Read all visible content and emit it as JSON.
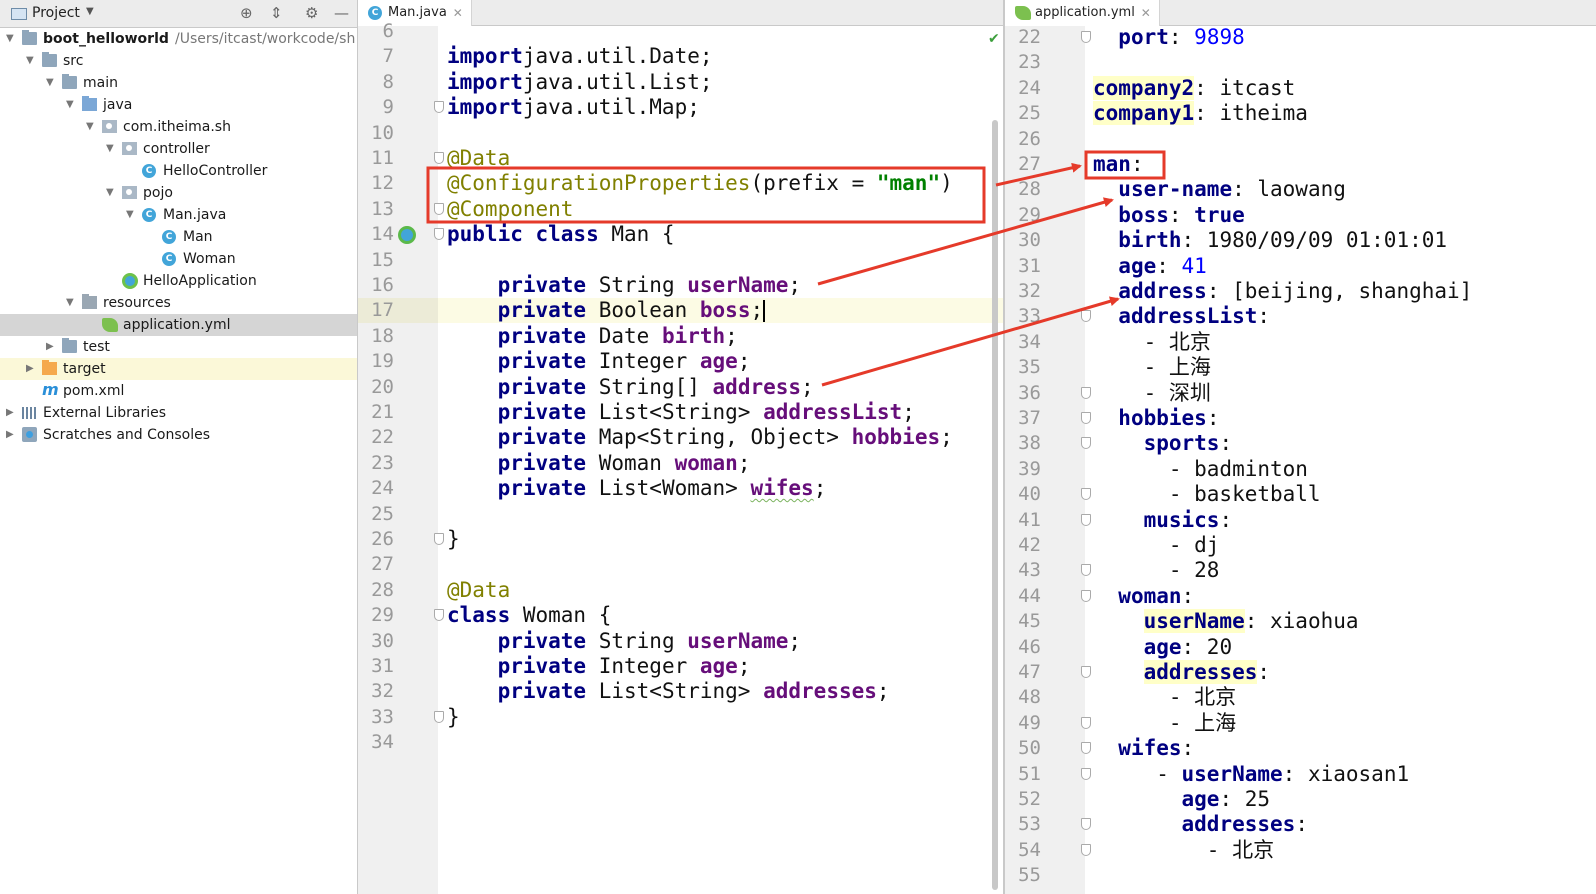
{
  "project_panel": {
    "header": {
      "title": "Project"
    },
    "tree": [
      {
        "label": "boot_helloworld",
        "path": "/Users/itcast/workcode/sh",
        "icon": "module-folder-icon",
        "depth": 0,
        "arrow": "down"
      },
      {
        "label": "src",
        "icon": "folder-icon",
        "depth": 1,
        "arrow": "down"
      },
      {
        "label": "main",
        "icon": "folder-icon",
        "depth": 2,
        "arrow": "down"
      },
      {
        "label": "java",
        "icon": "source-folder-icon",
        "depth": 3,
        "arrow": "down"
      },
      {
        "label": "com.itheima.sh",
        "icon": "package-icon",
        "depth": 4,
        "arrow": "down"
      },
      {
        "label": "controller",
        "icon": "package-icon",
        "depth": 5,
        "arrow": "down"
      },
      {
        "label": "HelloController",
        "icon": "class-icon",
        "depth": 6,
        "arrow": ""
      },
      {
        "label": "pojo",
        "icon": "package-icon",
        "depth": 5,
        "arrow": "down"
      },
      {
        "label": "Man.java",
        "icon": "class-icon",
        "depth": 6,
        "arrow": "down"
      },
      {
        "label": "Man",
        "icon": "class-icon",
        "depth": 7,
        "arrow": ""
      },
      {
        "label": "Woman",
        "icon": "class-icon",
        "depth": 7,
        "arrow": ""
      },
      {
        "label": "HelloApplication",
        "icon": "spring-app-icon",
        "depth": 5,
        "arrow": ""
      },
      {
        "label": "resources",
        "icon": "resources-folder-icon",
        "depth": 3,
        "arrow": "down"
      },
      {
        "label": "application.yml",
        "icon": "yml-file-icon",
        "depth": 4,
        "arrow": ""
      },
      {
        "label": "test",
        "icon": "folder-icon",
        "depth": 2,
        "arrow": "right"
      },
      {
        "label": "target",
        "icon": "target-folder-icon",
        "depth": 1,
        "arrow": "right"
      },
      {
        "label": "pom.xml",
        "icon": "maven-icon",
        "depth": 1,
        "arrow": ""
      },
      {
        "label": "External Libraries",
        "icon": "libraries-icon",
        "depth": 0,
        "arrow": "right"
      },
      {
        "label": "Scratches and Consoles",
        "icon": "scratches-icon",
        "depth": 0,
        "arrow": "right"
      }
    ]
  },
  "java_editor": {
    "tab": "Man.java",
    "lines": [
      {
        "n": "6",
        "segs": []
      },
      {
        "n": "7",
        "segs": [
          [
            "kw",
            "import"
          ],
          [
            "",
            "java.util.Date;"
          ]
        ]
      },
      {
        "n": "8",
        "segs": [
          [
            "kw",
            "import"
          ],
          [
            "",
            "java.util.List;"
          ]
        ]
      },
      {
        "n": "9",
        "segs": [
          [
            "kw",
            "import"
          ],
          [
            "",
            "java.util.Map;"
          ]
        ]
      },
      {
        "n": "10",
        "segs": []
      },
      {
        "n": "11",
        "segs": [
          [
            "ann",
            "@Data"
          ]
        ]
      },
      {
        "n": "12",
        "segs": [
          [
            "ann",
            "@ConfigurationProperties"
          ],
          [
            "",
            "(prefix = "
          ],
          [
            "str",
            "\"man\""
          ],
          [
            "",
            ")"
          ]
        ]
      },
      {
        "n": "13",
        "segs": [
          [
            "ann",
            "@Component"
          ]
        ]
      },
      {
        "n": "14",
        "segs": [
          [
            "kw",
            "public class"
          ],
          [
            "",
            " Man {"
          ]
        ]
      },
      {
        "n": "15",
        "segs": []
      },
      {
        "n": "16",
        "segs": [
          [
            "",
            "    "
          ],
          [
            "kw",
            "private"
          ],
          [
            "",
            " String "
          ],
          [
            "fld",
            "userName"
          ],
          [
            "",
            ";"
          ]
        ]
      },
      {
        "n": "17",
        "segs": [
          [
            "",
            "    "
          ],
          [
            "kw",
            "private"
          ],
          [
            "",
            " Boolean "
          ],
          [
            "fld",
            "boss"
          ],
          [
            "",
            ";"
          ]
        ]
      },
      {
        "n": "18",
        "segs": [
          [
            "",
            "    "
          ],
          [
            "kw",
            "private"
          ],
          [
            "",
            " Date "
          ],
          [
            "fld",
            "birth"
          ],
          [
            "",
            ";"
          ]
        ]
      },
      {
        "n": "19",
        "segs": [
          [
            "",
            "    "
          ],
          [
            "kw",
            "private"
          ],
          [
            "",
            " Integer "
          ],
          [
            "fld",
            "age"
          ],
          [
            "",
            ";"
          ]
        ]
      },
      {
        "n": "20",
        "segs": [
          [
            "",
            "    "
          ],
          [
            "kw",
            "private"
          ],
          [
            "",
            " String[] "
          ],
          [
            "fld",
            "address"
          ],
          [
            "",
            ";"
          ]
        ]
      },
      {
        "n": "21",
        "segs": [
          [
            "",
            "    "
          ],
          [
            "kw",
            "private"
          ],
          [
            "",
            " List<String> "
          ],
          [
            "fld",
            "addressList"
          ],
          [
            "",
            ";"
          ]
        ]
      },
      {
        "n": "22",
        "segs": [
          [
            "",
            "    "
          ],
          [
            "kw",
            "private"
          ],
          [
            "",
            " Map<String, Object> "
          ],
          [
            "fld",
            "hobbies"
          ],
          [
            "",
            ";"
          ]
        ]
      },
      {
        "n": "23",
        "segs": [
          [
            "",
            "    "
          ],
          [
            "kw",
            "private"
          ],
          [
            "",
            " Woman "
          ],
          [
            "fld",
            "woman"
          ],
          [
            "",
            ";"
          ]
        ]
      },
      {
        "n": "24",
        "segs": [
          [
            "",
            "    "
          ],
          [
            "kw",
            "private"
          ],
          [
            "",
            " List<Woman> "
          ],
          [
            "fld squig",
            "wifes"
          ],
          [
            "",
            ";"
          ]
        ]
      },
      {
        "n": "25",
        "segs": []
      },
      {
        "n": "26",
        "segs": [
          [
            "",
            "}"
          ]
        ]
      },
      {
        "n": "27",
        "segs": []
      },
      {
        "n": "28",
        "segs": [
          [
            "ann",
            "@Data"
          ]
        ]
      },
      {
        "n": "29",
        "segs": [
          [
            "kw",
            "class"
          ],
          [
            "",
            " Woman {"
          ]
        ]
      },
      {
        "n": "30",
        "segs": [
          [
            "",
            "    "
          ],
          [
            "kw",
            "private"
          ],
          [
            "",
            " String "
          ],
          [
            "fld",
            "userName"
          ],
          [
            "",
            ";"
          ]
        ]
      },
      {
        "n": "31",
        "segs": [
          [
            "",
            "    "
          ],
          [
            "kw",
            "private"
          ],
          [
            "",
            " Integer "
          ],
          [
            "fld",
            "age"
          ],
          [
            "",
            ";"
          ]
        ]
      },
      {
        "n": "32",
        "segs": [
          [
            "",
            "    "
          ],
          [
            "kw",
            "private"
          ],
          [
            "",
            " List<String> "
          ],
          [
            "fld",
            "addresses"
          ],
          [
            "",
            ";"
          ]
        ]
      },
      {
        "n": "33",
        "segs": [
          [
            "",
            "}"
          ]
        ]
      },
      {
        "n": "34",
        "segs": []
      }
    ]
  },
  "yml_editor": {
    "tab": "application.yml",
    "lines": [
      {
        "n": "22",
        "segs": [
          [
            "",
            "  "
          ],
          [
            "ykey",
            "port"
          ],
          [
            "",
            ": "
          ],
          [
            "ynum",
            "9898"
          ]
        ]
      },
      {
        "n": "23",
        "segs": []
      },
      {
        "n": "24",
        "segs": [
          [
            "ykey ykey-hl",
            "company2"
          ],
          [
            "",
            ": itcast"
          ]
        ]
      },
      {
        "n": "25",
        "segs": [
          [
            "ykey ykey-hl",
            "company1"
          ],
          [
            "",
            ": itheima"
          ]
        ]
      },
      {
        "n": "26",
        "segs": []
      },
      {
        "n": "27",
        "segs": [
          [
            "ykey",
            "man"
          ],
          [
            "",
            ":"
          ]
        ]
      },
      {
        "n": "28",
        "segs": [
          [
            "",
            "  "
          ],
          [
            "ykey",
            "user-name"
          ],
          [
            "",
            ": laowang"
          ]
        ]
      },
      {
        "n": "29",
        "segs": [
          [
            "",
            "  "
          ],
          [
            "ykey",
            "boss"
          ],
          [
            "",
            ": "
          ],
          [
            "ykey",
            "true"
          ]
        ]
      },
      {
        "n": "30",
        "segs": [
          [
            "",
            "  "
          ],
          [
            "ykey",
            "birth"
          ],
          [
            "",
            ": 1980/09/09 01:01:01"
          ]
        ]
      },
      {
        "n": "31",
        "segs": [
          [
            "",
            "  "
          ],
          [
            "ykey",
            "age"
          ],
          [
            "",
            ": "
          ],
          [
            "ynum",
            "41"
          ]
        ]
      },
      {
        "n": "32",
        "segs": [
          [
            "",
            "  "
          ],
          [
            "ykey",
            "address"
          ],
          [
            "",
            ": [beijing, shanghai]"
          ]
        ]
      },
      {
        "n": "33",
        "segs": [
          [
            "",
            "  "
          ],
          [
            "ykey",
            "addressList"
          ],
          [
            "",
            ":"
          ]
        ]
      },
      {
        "n": "34",
        "segs": [
          [
            "",
            "    - 北京"
          ]
        ]
      },
      {
        "n": "35",
        "segs": [
          [
            "",
            "    - 上海"
          ]
        ]
      },
      {
        "n": "36",
        "segs": [
          [
            "",
            "    - 深圳"
          ]
        ]
      },
      {
        "n": "37",
        "segs": [
          [
            "",
            "  "
          ],
          [
            "ykey",
            "hobbies"
          ],
          [
            "",
            ":"
          ]
        ]
      },
      {
        "n": "38",
        "segs": [
          [
            "",
            "    "
          ],
          [
            "ykey",
            "sports"
          ],
          [
            "",
            ":"
          ]
        ]
      },
      {
        "n": "39",
        "segs": [
          [
            "",
            "      - badminton"
          ]
        ]
      },
      {
        "n": "40",
        "segs": [
          [
            "",
            "      - basketball"
          ]
        ]
      },
      {
        "n": "41",
        "segs": [
          [
            "",
            "    "
          ],
          [
            "ykey",
            "musics"
          ],
          [
            "",
            ":"
          ]
        ]
      },
      {
        "n": "42",
        "segs": [
          [
            "",
            "      - dj"
          ]
        ]
      },
      {
        "n": "43",
        "segs": [
          [
            "",
            "      - 28"
          ]
        ]
      },
      {
        "n": "44",
        "segs": [
          [
            "",
            "  "
          ],
          [
            "ykey",
            "woman"
          ],
          [
            "",
            ":"
          ]
        ]
      },
      {
        "n": "45",
        "segs": [
          [
            "",
            "    "
          ],
          [
            "ykey ykey-hl",
            "userName"
          ],
          [
            "",
            ": xiaohua"
          ]
        ]
      },
      {
        "n": "46",
        "segs": [
          [
            "",
            "    "
          ],
          [
            "ykey",
            "age"
          ],
          [
            "",
            ": 20"
          ]
        ]
      },
      {
        "n": "47",
        "segs": [
          [
            "",
            "    "
          ],
          [
            "ykey ykey-hl",
            "addresses"
          ],
          [
            "",
            ":"
          ]
        ]
      },
      {
        "n": "48",
        "segs": [
          [
            "",
            "      - 北京"
          ]
        ]
      },
      {
        "n": "49",
        "segs": [
          [
            "",
            "      - 上海"
          ]
        ]
      },
      {
        "n": "50",
        "segs": [
          [
            "",
            "  "
          ],
          [
            "ykey",
            "wifes"
          ],
          [
            "",
            ":"
          ]
        ]
      },
      {
        "n": "51",
        "segs": [
          [
            "",
            "     - "
          ],
          [
            "ykey",
            "userName"
          ],
          [
            "",
            ": xiaosan1"
          ]
        ]
      },
      {
        "n": "52",
        "segs": [
          [
            "",
            "       "
          ],
          [
            "ykey",
            "age"
          ],
          [
            "",
            ": 25"
          ]
        ]
      },
      {
        "n": "53",
        "segs": [
          [
            "",
            "       "
          ],
          [
            "ykey",
            "addresses"
          ],
          [
            "",
            ":"
          ]
        ]
      },
      {
        "n": "54",
        "segs": [
          [
            "",
            "         - 北京"
          ]
        ]
      },
      {
        "n": "55",
        "segs": []
      }
    ]
  },
  "colors": {
    "annotation_box": "#e53a2a",
    "arrow": "#e53a2a"
  }
}
